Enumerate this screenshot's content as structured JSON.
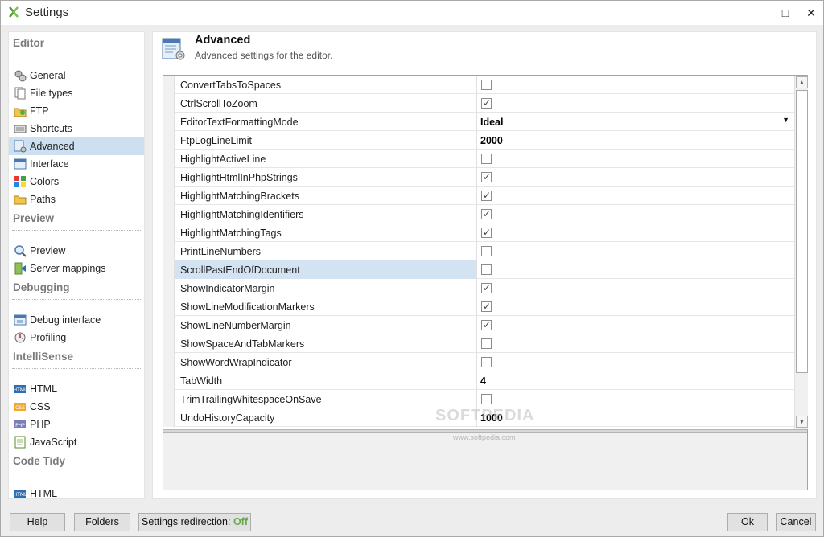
{
  "window": {
    "title": "Settings",
    "controls": [
      "minimize",
      "maximize",
      "close"
    ]
  },
  "sidebar": {
    "sections": [
      {
        "title": "Editor",
        "items": [
          {
            "label": "General",
            "icon": "gears-icon"
          },
          {
            "label": "File types",
            "icon": "file-types-icon"
          },
          {
            "label": "FTP",
            "icon": "ftp-icon"
          },
          {
            "label": "Shortcuts",
            "icon": "keyboard-icon"
          },
          {
            "label": "Advanced",
            "icon": "advanced-icon",
            "selected": true
          },
          {
            "label": "Interface",
            "icon": "interface-icon"
          },
          {
            "label": "Colors",
            "icon": "colors-icon"
          },
          {
            "label": "Paths",
            "icon": "folder-icon"
          }
        ]
      },
      {
        "title": "Preview",
        "items": [
          {
            "label": "Preview",
            "icon": "magnifier-icon"
          },
          {
            "label": "Server mappings",
            "icon": "server-mappings-icon"
          }
        ]
      },
      {
        "title": "Debugging",
        "items": [
          {
            "label": "Debug interface",
            "icon": "debug-interface-icon"
          },
          {
            "label": "Profiling",
            "icon": "profiling-icon"
          }
        ]
      },
      {
        "title": "IntelliSense",
        "items": [
          {
            "label": "HTML",
            "icon": "html-icon"
          },
          {
            "label": "CSS",
            "icon": "css-icon"
          },
          {
            "label": "PHP",
            "icon": "php-icon"
          },
          {
            "label": "JavaScript",
            "icon": "javascript-icon"
          }
        ]
      },
      {
        "title": "Code Tidy",
        "items": [
          {
            "label": "HTML",
            "icon": "html-icon"
          },
          {
            "label": "CSS",
            "icon": "css-icon"
          }
        ]
      }
    ]
  },
  "page": {
    "title": "Advanced",
    "subtitle": "Advanced settings for the editor."
  },
  "properties": [
    {
      "name": "ConvertTabsToSpaces",
      "type": "checkbox",
      "checked": false
    },
    {
      "name": "CtrlScrollToZoom",
      "type": "checkbox",
      "checked": true
    },
    {
      "name": "EditorTextFormattingMode",
      "type": "dropdown",
      "value": "Ideal"
    },
    {
      "name": "FtpLogLineLimit",
      "type": "text",
      "value": "2000"
    },
    {
      "name": "HighlightActiveLine",
      "type": "checkbox",
      "checked": false
    },
    {
      "name": "HighlightHtmlInPhpStrings",
      "type": "checkbox",
      "checked": true
    },
    {
      "name": "HighlightMatchingBrackets",
      "type": "checkbox",
      "checked": true
    },
    {
      "name": "HighlightMatchingIdentifiers",
      "type": "checkbox",
      "checked": true
    },
    {
      "name": "HighlightMatchingTags",
      "type": "checkbox",
      "checked": true
    },
    {
      "name": "PrintLineNumbers",
      "type": "checkbox",
      "checked": false
    },
    {
      "name": "ScrollPastEndOfDocument",
      "type": "checkbox",
      "checked": false,
      "selected": true
    },
    {
      "name": "ShowIndicatorMargin",
      "type": "checkbox",
      "checked": true
    },
    {
      "name": "ShowLineModificationMarkers",
      "type": "checkbox",
      "checked": true
    },
    {
      "name": "ShowLineNumberMargin",
      "type": "checkbox",
      "checked": true
    },
    {
      "name": "ShowSpaceAndTabMarkers",
      "type": "checkbox",
      "checked": false
    },
    {
      "name": "ShowWordWrapIndicator",
      "type": "checkbox",
      "checked": false
    },
    {
      "name": "TabWidth",
      "type": "text",
      "value": "4"
    },
    {
      "name": "TrimTrailingWhitespaceOnSave",
      "type": "checkbox",
      "checked": false
    },
    {
      "name": "UndoHistoryCapacity",
      "type": "text",
      "value": "1000"
    }
  ],
  "watermark": {
    "text": "SOFTPEDIA",
    "url": "www.softpedia.com"
  },
  "footer": {
    "help": "Help",
    "folders": "Folders",
    "redirection_label": "Settings redirection: ",
    "redirection_value": "Off",
    "ok": "Ok",
    "cancel": "Cancel"
  },
  "colors": {
    "selection": "#cde0f2",
    "redirection_off": "#6aa84f"
  }
}
